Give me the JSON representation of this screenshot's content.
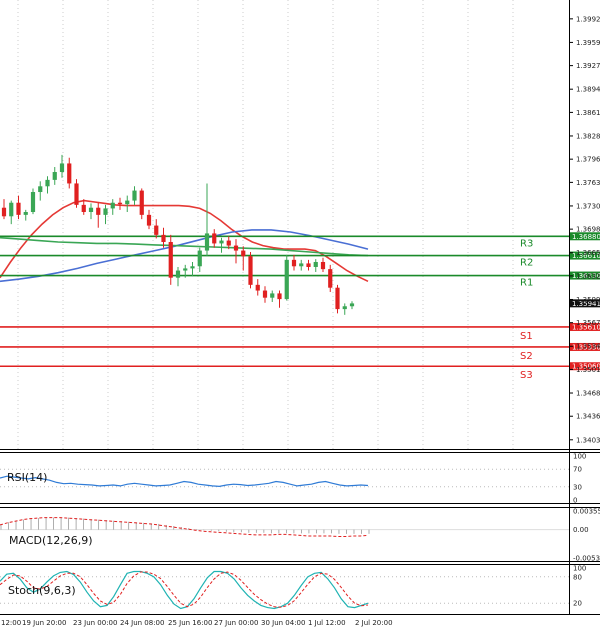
{
  "chart_data": [
    {
      "type": "candlestick",
      "panel": "price",
      "price_axis_labels": [
        "1.39925",
        "1.39595",
        "1.39270",
        "1.38940",
        "1.38615",
        "1.38285",
        "1.37960",
        "1.37635",
        "1.37305",
        "1.36980",
        "1.36650",
        "1.36325",
        "1.35995",
        "1.35670",
        "1.35340",
        "1.35015",
        "1.34685",
        "1.34360",
        "1.34030"
      ],
      "time_labels": [
        "12:00",
        "19 Jun 20:00",
        "23 Jun 00:00",
        "24 Jun 08:00",
        "25 Jun 16:00",
        "27 Jun 00:00",
        "30 Jun 04:00",
        "1 Jul 12:00",
        "2 Jul 20:00"
      ],
      "ylim": [
        1.3395,
        1.4007
      ],
      "candles": [
        {
          "o": 1.3728,
          "h": 1.374,
          "l": 1.3712,
          "c": 1.3716
        },
        {
          "o": 1.3716,
          "h": 1.3738,
          "l": 1.3705,
          "c": 1.3735
        },
        {
          "o": 1.3735,
          "h": 1.3745,
          "l": 1.3712,
          "c": 1.3718
        },
        {
          "o": 1.3718,
          "h": 1.3725,
          "l": 1.371,
          "c": 1.3722
        },
        {
          "o": 1.3722,
          "h": 1.3755,
          "l": 1.3719,
          "c": 1.375
        },
        {
          "o": 1.375,
          "h": 1.3765,
          "l": 1.3738,
          "c": 1.3758
        },
        {
          "o": 1.3758,
          "h": 1.3772,
          "l": 1.3748,
          "c": 1.3767
        },
        {
          "o": 1.3767,
          "h": 1.3785,
          "l": 1.376,
          "c": 1.3778
        },
        {
          "o": 1.3778,
          "h": 1.3802,
          "l": 1.377,
          "c": 1.379
        },
        {
          "o": 1.379,
          "h": 1.3798,
          "l": 1.3755,
          "c": 1.3762
        },
        {
          "o": 1.3762,
          "h": 1.3768,
          "l": 1.3728,
          "c": 1.3732
        },
        {
          "o": 1.3732,
          "h": 1.374,
          "l": 1.3718,
          "c": 1.3722
        },
        {
          "o": 1.3722,
          "h": 1.3734,
          "l": 1.3712,
          "c": 1.3728
        },
        {
          "o": 1.3728,
          "h": 1.3735,
          "l": 1.37,
          "c": 1.3718
        },
        {
          "o": 1.3718,
          "h": 1.3732,
          "l": 1.3705,
          "c": 1.3727
        },
        {
          "o": 1.3727,
          "h": 1.374,
          "l": 1.3718,
          "c": 1.3735
        },
        {
          "o": 1.3735,
          "h": 1.3742,
          "l": 1.3725,
          "c": 1.3733
        },
        {
          "o": 1.3733,
          "h": 1.3745,
          "l": 1.3722,
          "c": 1.3738
        },
        {
          "o": 1.3738,
          "h": 1.3758,
          "l": 1.3732,
          "c": 1.3752
        },
        {
          "o": 1.3752,
          "h": 1.3755,
          "l": 1.3712,
          "c": 1.3718
        },
        {
          "o": 1.3718,
          "h": 1.3725,
          "l": 1.3698,
          "c": 1.3703
        },
        {
          "o": 1.3703,
          "h": 1.3712,
          "l": 1.3685,
          "c": 1.369
        },
        {
          "o": 1.369,
          "h": 1.37,
          "l": 1.3672,
          "c": 1.368
        },
        {
          "o": 1.368,
          "h": 1.369,
          "l": 1.362,
          "c": 1.363
        },
        {
          "o": 1.363,
          "h": 1.3645,
          "l": 1.3618,
          "c": 1.364
        },
        {
          "o": 1.364,
          "h": 1.3648,
          "l": 1.363,
          "c": 1.3643
        },
        {
          "o": 1.3643,
          "h": 1.3652,
          "l": 1.3632,
          "c": 1.3646
        },
        {
          "o": 1.3646,
          "h": 1.3672,
          "l": 1.3638,
          "c": 1.3668
        },
        {
          "o": 1.3668,
          "h": 1.3762,
          "l": 1.366,
          "c": 1.3692
        },
        {
          "o": 1.3692,
          "h": 1.3698,
          "l": 1.3672,
          "c": 1.3678
        },
        {
          "o": 1.3678,
          "h": 1.3686,
          "l": 1.3665,
          "c": 1.3682
        },
        {
          "o": 1.3682,
          "h": 1.3688,
          "l": 1.367,
          "c": 1.3675
        },
        {
          "o": 1.3675,
          "h": 1.3684,
          "l": 1.365,
          "c": 1.3668
        },
        {
          "o": 1.3668,
          "h": 1.3674,
          "l": 1.364,
          "c": 1.366
        },
        {
          "o": 1.366,
          "h": 1.3666,
          "l": 1.3615,
          "c": 1.362
        },
        {
          "o": 1.362,
          "h": 1.3628,
          "l": 1.3605,
          "c": 1.3612
        },
        {
          "o": 1.3612,
          "h": 1.3618,
          "l": 1.3595,
          "c": 1.3602
        },
        {
          "o": 1.3602,
          "h": 1.3612,
          "l": 1.3596,
          "c": 1.3608
        },
        {
          "o": 1.3608,
          "h": 1.3612,
          "l": 1.3588,
          "c": 1.36
        },
        {
          "o": 1.36,
          "h": 1.3662,
          "l": 1.3598,
          "c": 1.3655
        },
        {
          "o": 1.3655,
          "h": 1.3662,
          "l": 1.364,
          "c": 1.3646
        },
        {
          "o": 1.3646,
          "h": 1.3655,
          "l": 1.364,
          "c": 1.365
        },
        {
          "o": 1.365,
          "h": 1.3655,
          "l": 1.364,
          "c": 1.3645
        },
        {
          "o": 1.3645,
          "h": 1.3656,
          "l": 1.3638,
          "c": 1.3652
        },
        {
          "o": 1.3652,
          "h": 1.3658,
          "l": 1.3638,
          "c": 1.3642
        },
        {
          "o": 1.3642,
          "h": 1.3648,
          "l": 1.361,
          "c": 1.3616
        },
        {
          "o": 1.3616,
          "h": 1.362,
          "l": 1.358,
          "c": 1.3586
        },
        {
          "o": 1.3586,
          "h": 1.3594,
          "l": 1.3578,
          "c": 1.359
        },
        {
          "o": 1.359,
          "h": 1.3597,
          "l": 1.3586,
          "c": 1.3594
        }
      ],
      "moving_averages": [
        {
          "color": "#e53935",
          "values": [
            1.363,
            1.3652,
            1.3672,
            1.369,
            1.3705,
            1.3718,
            1.3728,
            1.3735,
            1.3738,
            1.3736,
            1.3734,
            1.3732,
            1.3731,
            1.3731,
            1.3731,
            1.3731,
            1.3731,
            1.3731,
            1.373,
            1.3727,
            1.372,
            1.371,
            1.3698,
            1.3688,
            1.368,
            1.3675,
            1.3672,
            1.367,
            1.367,
            1.367,
            1.3668,
            1.366,
            1.365,
            1.364,
            1.3632,
            1.3625
          ]
        },
        {
          "color": "#4a6fd4",
          "values": [
            1.3625,
            1.3628,
            1.3632,
            1.3637,
            1.3643,
            1.365,
            1.3656,
            1.3662,
            1.3668,
            1.3674,
            1.3681,
            1.3688,
            1.3694,
            1.3697,
            1.3697,
            1.3694,
            1.3689,
            1.3683,
            1.3677,
            1.367
          ]
        },
        {
          "color": "#3aa655",
          "values": [
            1.3686,
            1.3684,
            1.3682,
            1.368,
            1.3679,
            1.3678,
            1.3678,
            1.3677,
            1.3676,
            1.3675,
            1.3674,
            1.3673,
            1.3672,
            1.3671,
            1.367,
            1.3668,
            1.3666,
            1.3664,
            1.3662,
            1.3661
          ]
        }
      ],
      "levels": [
        {
          "name": "R3",
          "value": 1.3688,
          "label": "1.36880",
          "color": "#1a8a2a"
        },
        {
          "name": "R2",
          "value": 1.3661,
          "label": "1.36610",
          "color": "#1a8a2a"
        },
        {
          "name": "R1",
          "value": 1.3633,
          "label": "1.36330",
          "color": "#1a8a2a"
        },
        {
          "name": "S1",
          "value": 1.3561,
          "label": "1.35610",
          "color": "#e02020"
        },
        {
          "name": "S2",
          "value": 1.3533,
          "label": "1.35330",
          "color": "#e02020"
        },
        {
          "name": "S3",
          "value": 1.3506,
          "label": "1.35060",
          "color": "#e02020"
        }
      ],
      "current_price_label": "1.35941",
      "current_price": 1.35941,
      "colors": {
        "bull": "#3aa655",
        "bear": "#e02020",
        "axis": "#000000",
        "grid": "#cccccc"
      }
    },
    {
      "type": "line",
      "panel": "rsi",
      "name": "RSI(14)",
      "axis_labels": [
        "100",
        "70",
        "30",
        "0"
      ],
      "ylim": [
        0,
        100
      ],
      "values": [
        50,
        54,
        52,
        50,
        48,
        51,
        48,
        45,
        40,
        37,
        38,
        36,
        35,
        34,
        32,
        33,
        34,
        32,
        36,
        38,
        36,
        34,
        32,
        33,
        34,
        38,
        42,
        40,
        36,
        34,
        32,
        31,
        34,
        36,
        35,
        33,
        34,
        36,
        38,
        42,
        40,
        36,
        32,
        34,
        36,
        40,
        42,
        38,
        34,
        32,
        33,
        34,
        33
      ]
    },
    {
      "type": "bar",
      "panel": "macd",
      "name": "MACD(12,26,9)",
      "axis_labels": [
        "0.00355",
        "0.00",
        "-0.00539"
      ],
      "ylim": [
        -0.00539,
        0.00355
      ],
      "histogram": [
        0.001,
        0.0014,
        0.0017,
        0.0019,
        0.0021,
        0.0022,
        0.0023,
        0.0023,
        0.0023,
        0.0023,
        0.0022,
        0.0021,
        0.002,
        0.0019,
        0.0018,
        0.0017,
        0.0016,
        0.0015,
        0.0014,
        0.0013,
        0.0012,
        0.0011,
        0.0009,
        0.0007,
        0.0005,
        0.0003,
        0.0001,
        -0.0001,
        -0.0002,
        -0.0003,
        -0.0004,
        -0.0005,
        -0.0005,
        -0.0006,
        -0.0006,
        -0.0006,
        -0.0007,
        -0.0007,
        -0.0007,
        -0.0007,
        -0.0007,
        -0.0007,
        -0.0007,
        -0.0007,
        -0.0007,
        -0.0008,
        -0.0008,
        -0.0008,
        -0.0008,
        -0.0008
      ],
      "signal": [
        0.0009,
        0.0013,
        0.0016,
        0.0019,
        0.0021,
        0.0022,
        0.0023,
        0.0023,
        0.0023,
        0.0022,
        0.0021,
        0.002,
        0.0019,
        0.0018,
        0.0017,
        0.0016,
        0.0015,
        0.0014,
        0.0013,
        0.0012,
        0.0011,
        0.0009,
        0.0007,
        0.0005,
        0.0003,
        0.0001,
        -0.0001,
        -0.0003,
        -0.0004,
        -0.0005,
        -0.0006,
        -0.0007,
        -0.0008,
        -0.0009,
        -0.001,
        -0.001,
        -0.001,
        -0.0009,
        -0.0009,
        -0.001,
        -0.0011,
        -0.0012,
        -0.0012,
        -0.0012,
        -0.0012,
        -0.0013,
        -0.0013,
        -0.0012,
        -0.0012,
        -0.0011
      ]
    },
    {
      "type": "line",
      "panel": "stoch",
      "name": "Stoch(9,6,3)",
      "axis_labels": [
        "100",
        "80",
        "20"
      ],
      "ylim": [
        0,
        100
      ],
      "k": [
        70,
        86,
        88,
        75,
        55,
        45,
        52,
        68,
        82,
        90,
        92,
        85,
        68,
        45,
        25,
        12,
        15,
        35,
        62,
        88,
        92,
        92,
        88,
        80,
        62,
        38,
        18,
        8,
        12,
        30,
        55,
        78,
        92,
        92,
        88,
        75,
        55,
        38,
        25,
        15,
        10,
        8,
        12,
        20,
        38,
        60,
        80,
        88,
        90,
        75,
        55,
        30,
        12,
        10,
        15,
        20
      ],
      "d": [
        62,
        74,
        84,
        82,
        70,
        55,
        52,
        58,
        70,
        82,
        88,
        88,
        80,
        62,
        42,
        25,
        17,
        22,
        40,
        65,
        82,
        91,
        91,
        86,
        76,
        58,
        38,
        20,
        12,
        18,
        34,
        56,
        75,
        88,
        91,
        85,
        72,
        56,
        40,
        28,
        18,
        12,
        11,
        15,
        26,
        44,
        63,
        80,
        88,
        86,
        74,
        56,
        36,
        20,
        14,
        16
      ]
    }
  ]
}
